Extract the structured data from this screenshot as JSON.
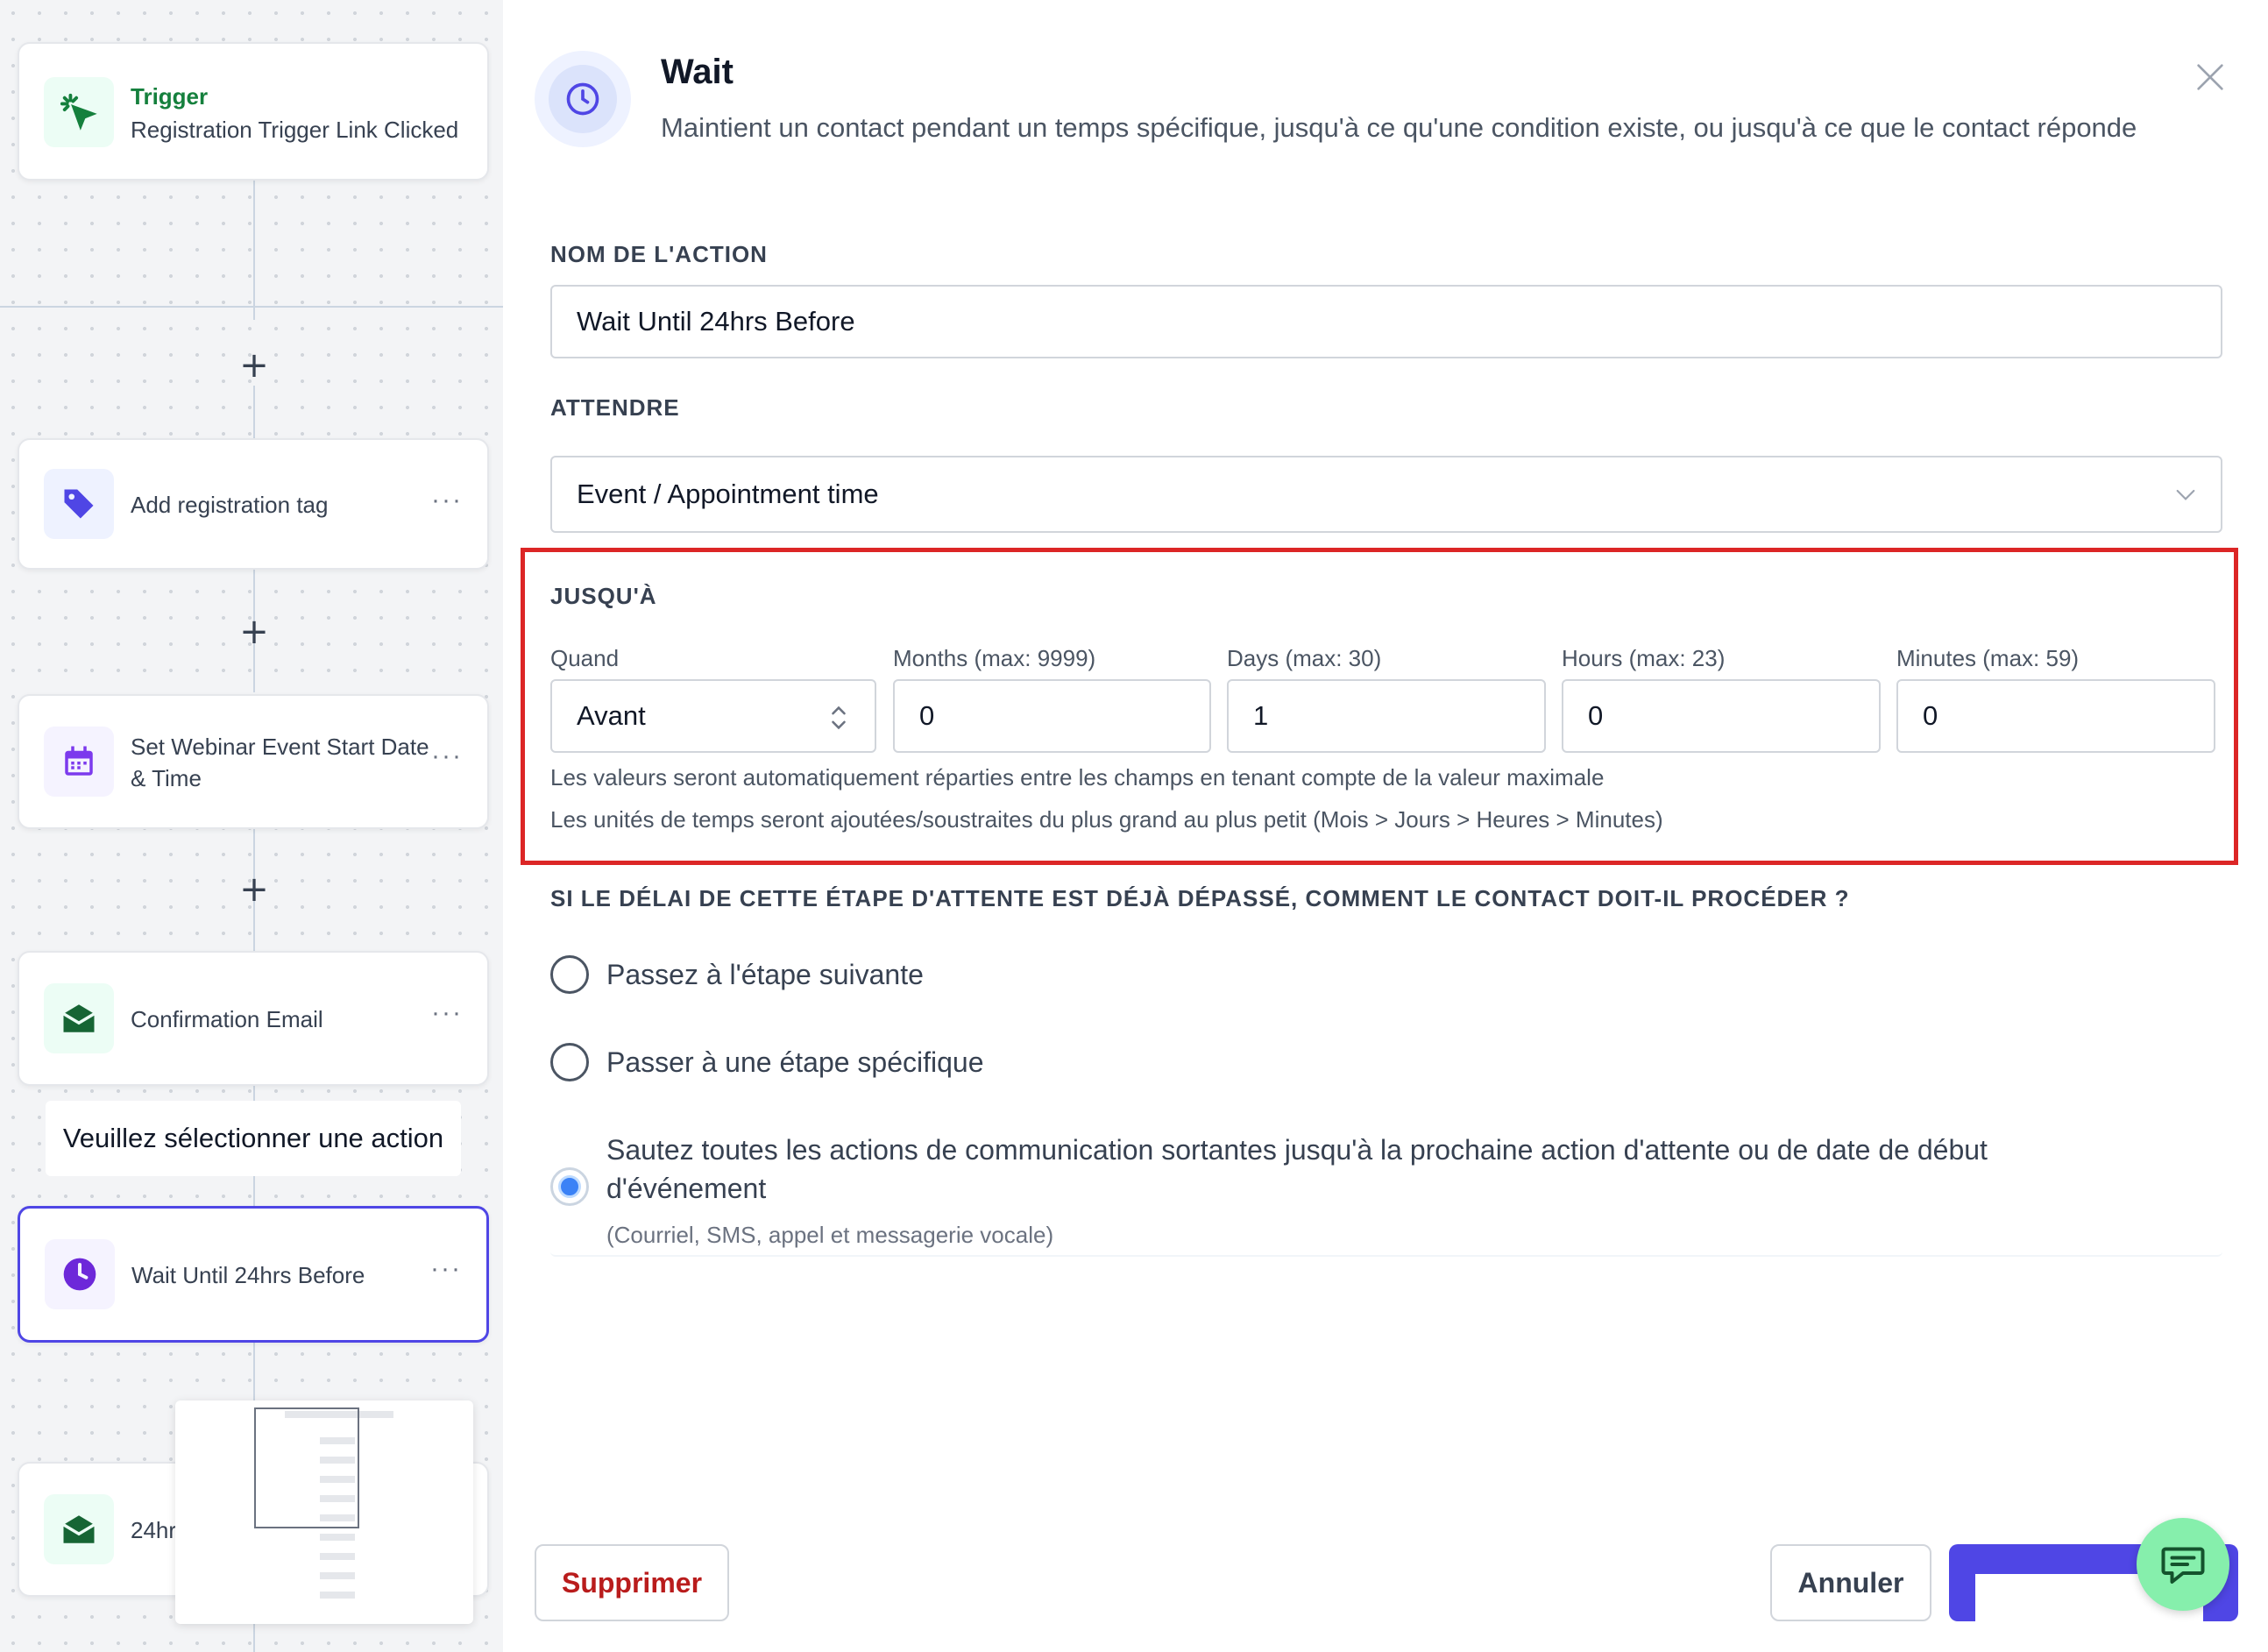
{
  "workflow": {
    "trigger": {
      "title": "Trigger",
      "subtitle": "Registration Trigger Link Clicked"
    },
    "nodes": [
      {
        "label": "Add registration tag",
        "icon": "tag-icon"
      },
      {
        "label": "Set Webinar Event Start Date & Time",
        "icon": "calendar-icon"
      },
      {
        "label": "Confirmation Email",
        "icon": "email-icon"
      },
      {
        "label": "Wait Until 24hrs Before",
        "icon": "clock-icon"
      },
      {
        "label": "24hr",
        "icon": "email-icon"
      }
    ],
    "tooltip": "Veuillez sélectionner une action",
    "more_glyph": "···",
    "plus_glyph": "+"
  },
  "panel": {
    "title": "Wait",
    "subtitle": "Maintient un contact pendant un temps spécifique, jusqu'à ce qu'une condition existe, ou jusqu'à ce que le contact réponde",
    "action_name_label": "NOM DE L'ACTION",
    "action_name_value": "Wait Until 24hrs Before",
    "wait_label": "ATTENDRE",
    "wait_value": "Event / Appointment time",
    "until_label": "JUSQU'À",
    "fields": {
      "when": {
        "label": "Quand",
        "value": "Avant"
      },
      "months": {
        "label": "Months (max: 9999)",
        "value": "0"
      },
      "days": {
        "label": "Days (max: 30)",
        "value": "1"
      },
      "hours": {
        "label": "Hours (max: 23)",
        "value": "0"
      },
      "minutes": {
        "label": "Minutes (max: 59)",
        "value": "0"
      }
    },
    "hint_1": "Les valeurs seront automatiquement réparties entre les champs en tenant compte de la valeur maximale",
    "hint_2": "Les unités de temps seront ajoutées/soustraites du plus grand au plus petit (Mois > Jours > Heures > Minutes)",
    "question": "SI LE DÉLAI DE CETTE ÉTAPE D'ATTENTE EST DÉJÀ DÉPASSÉ, COMMENT LE CONTACT DOIT-IL PROCÉDER ?",
    "options": [
      {
        "label": "Passez à l'étape suivante",
        "checked": false
      },
      {
        "label": "Passer à une étape spécifique",
        "checked": false
      },
      {
        "label": "Sautez toutes les actions de communication sortantes jusqu'à la prochaine action d'attente ou de date de début d'événement",
        "sub": "(Courriel, SMS, appel et messagerie vocale)",
        "checked": true
      }
    ],
    "buttons": {
      "delete": "Supprimer",
      "cancel": "Annuler"
    }
  },
  "colors": {
    "accent": "#4f46e5",
    "highlight": "#dc2626",
    "delete_text": "#b91c1c",
    "radio_checked": "#3b82f6",
    "chat_fab": "#86efac"
  }
}
